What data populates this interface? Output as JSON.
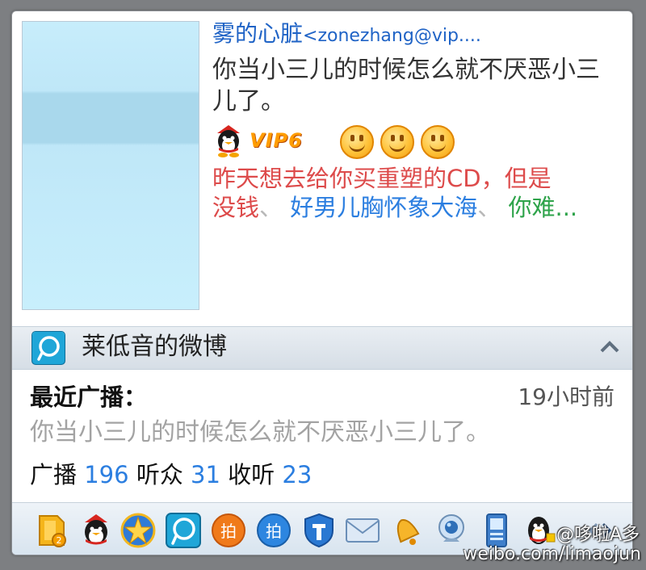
{
  "profile": {
    "nickname": "雾的心脏",
    "email": "<zonezhang@vip....",
    "signature": "你当小三儿的时候怎么就不厌恶小三儿了。",
    "vip_level": "VIP6",
    "recent_items": [
      {
        "text": "昨天想去给你买重塑的CD，但是",
        "color": "#dd4b4b"
      },
      {
        "text": "没钱",
        "color": "#dd4b4b"
      },
      {
        "text": "好男儿胸怀象大海",
        "color": "#2b7ee0"
      },
      {
        "text": "你难...",
        "color": "#2ea34a"
      }
    ],
    "separator": "、"
  },
  "weibo": {
    "title": "莱低音的微博",
    "recent_label": "最近广播：",
    "recent_time": "19小时前",
    "recent_text": "你当小三儿的时候怎么就不厌恶小三儿了。",
    "stats": {
      "broadcast_label": "广播",
      "broadcast_value": "196",
      "listeners_label": "听众",
      "listeners_value": "31",
      "following_label": "收听",
      "following_value": "23"
    }
  },
  "toolbar": {
    "icons": [
      "qzone-icon",
      "qq-show-icon",
      "star-icon",
      "weibo-icon",
      "paipai-icon",
      "pai-blue-icon",
      "security-icon",
      "mail-icon",
      "bell-icon",
      "webcam-icon",
      "mobile-icon",
      "penguin-icon",
      "scroll-arrows-icon"
    ]
  },
  "watermark": {
    "line1": "@哆啦A多",
    "line2": "weibo.com/limaojun"
  }
}
